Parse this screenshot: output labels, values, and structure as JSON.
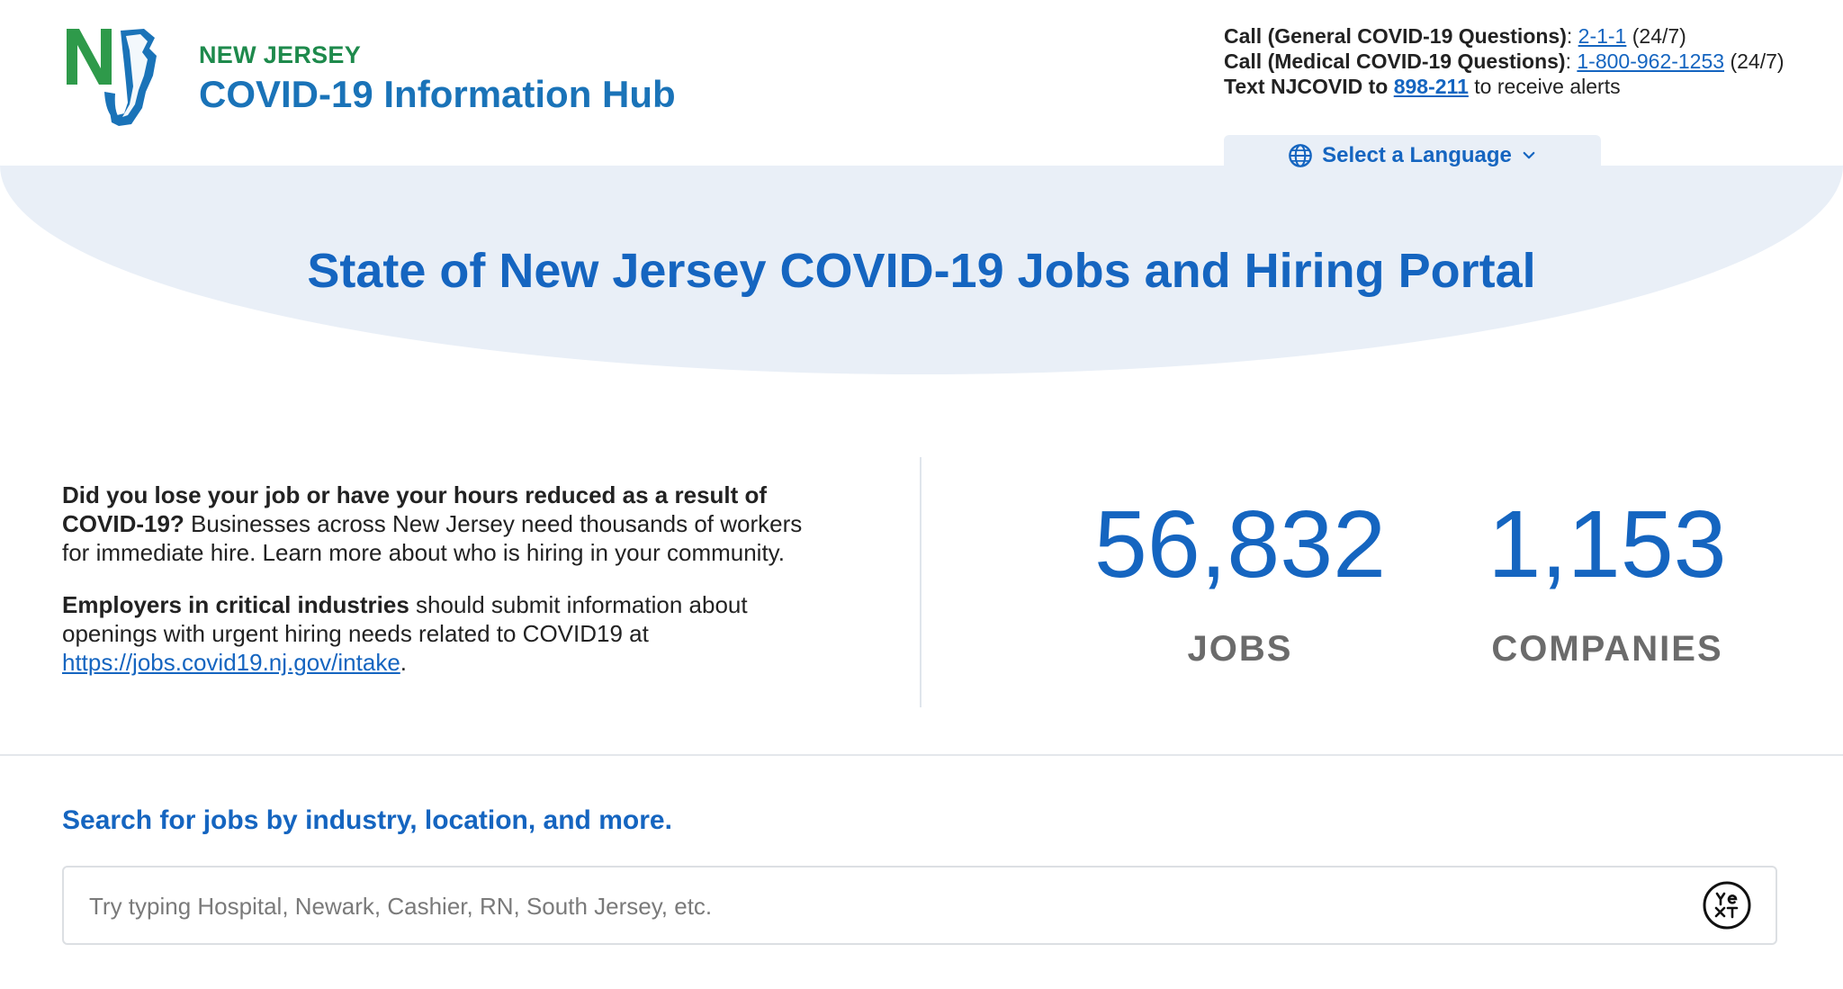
{
  "brand": {
    "state": "NEW JERSEY",
    "title": "COVID-19 Information Hub",
    "logo_icon": "nj-logo-icon"
  },
  "contact": {
    "general_label": "Call (General COVID-19 Questions)",
    "general_number": "2-1-1",
    "general_hours": "(24/7)",
    "medical_label": "Call (Medical COVID-19 Questions)",
    "medical_number": "1-800-962-1253",
    "medical_hours": "(24/7)",
    "text_label": "Text NJCOVID to",
    "text_number": "898-211",
    "text_suffix": "to receive alerts"
  },
  "language": {
    "label": "Select a Language",
    "icon": "globe-icon",
    "chevron": "chevron-down-icon"
  },
  "hero": {
    "title": "State of New Jersey COVID-19 Jobs and Hiring Portal"
  },
  "intro": {
    "p1_bold": "Did you lose your job or have your hours reduced as a result of COVID-19?",
    "p1_rest": " Businesses across New Jersey need thousands of workers for immediate hire. Learn more about who is hiring in your community.",
    "p2_bold": "Employers in critical industries",
    "p2_rest": " should submit information about openings with urgent hiring needs related to COVID19 at ",
    "p2_link": "https://jobs.covid19.nj.gov/intake",
    "p2_end": "."
  },
  "stats": {
    "jobs_value": "56,832",
    "jobs_label": "JOBS",
    "companies_value": "1,153",
    "companies_label": "COMPANIES"
  },
  "search": {
    "heading": "Search for jobs by industry, location, and more.",
    "placeholder": "Try typing Hospital, Newark, Cashier, RN, South Jersey, etc.",
    "value": "",
    "logo": "yext-logo-icon"
  },
  "colors": {
    "brand_green": "#1e8a4c",
    "brand_blue": "#1a73b8",
    "link_blue": "#1565c0",
    "hero_bg": "#e9eff7",
    "stat_label_gray": "#6b6b6b"
  }
}
